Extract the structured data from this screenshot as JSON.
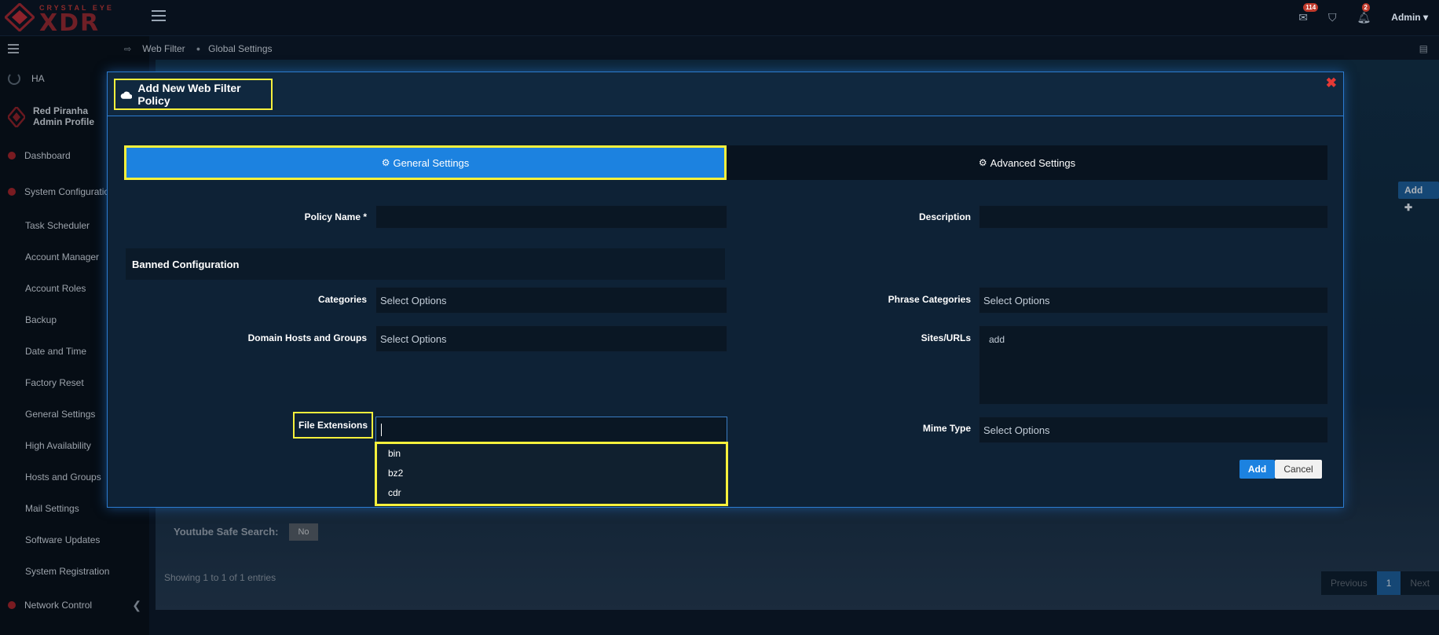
{
  "brand": {
    "top": "CRYSTAL EYE",
    "main": "XDR"
  },
  "topbar": {
    "mail_badge": "114",
    "notif_badge": "2",
    "admin_label": "Admin",
    "icons": [
      "mail-icon",
      "shield-icon",
      "bell-icon",
      "caret-down-icon"
    ]
  },
  "sidebar": {
    "ha_label": "HA",
    "profile_name": "Red Piranha",
    "profile_role": "Admin Profile",
    "dashboard": "Dashboard",
    "system_config": "System Configuratio",
    "sub_items": [
      "Task Scheduler",
      "Account Manager",
      "Account Roles",
      "Backup",
      "Date and Time",
      "Factory Reset",
      "General Settings",
      "High Availability",
      "Hosts and Groups",
      "Mail Settings",
      "Software Updates",
      "System Registration"
    ],
    "network_control": "Network Control"
  },
  "breadcrumb": {
    "item1": "Web Filter",
    "item2": "Global Settings"
  },
  "background": {
    "add_label": "Add",
    "youtube_label": "Youtube Safe Search:",
    "youtube_value": "No",
    "showing": "Showing 1 to 1 of 1 entries",
    "pager": {
      "previous": "Previous",
      "page": "1",
      "next": "Next"
    }
  },
  "modal": {
    "title": "Add New Web Filter Policy",
    "close_glyph": "✖",
    "tabs": {
      "general": "General Settings",
      "advanced": "Advanced Settings"
    },
    "fields": {
      "policy_name_label": "Policy Name *",
      "description_label": "Description",
      "banned_heading": "Banned Configuration",
      "categories_label": "Categories",
      "categories_placeholder": "Select Options",
      "phrase_categories_label": "Phrase Categories",
      "phrase_categories_placeholder": "Select Options",
      "domain_hosts_label": "Domain Hosts and Groups",
      "domain_hosts_placeholder": "Select Options",
      "sites_urls_label": "Sites/URLs",
      "sites_urls_tag": "add",
      "file_extensions_label": "File Extensions",
      "mime_type_label": "Mime Type",
      "mime_type_placeholder": "Select Options"
    },
    "file_extension_options": [
      "bin",
      "bz2",
      "cdr"
    ],
    "buttons": {
      "add": "Add",
      "cancel": "Cancel"
    }
  },
  "colors": {
    "accent": "#1c82e0",
    "highlight": "#f6f03c",
    "brand_red": "#a2252c",
    "close": "#e53935"
  }
}
